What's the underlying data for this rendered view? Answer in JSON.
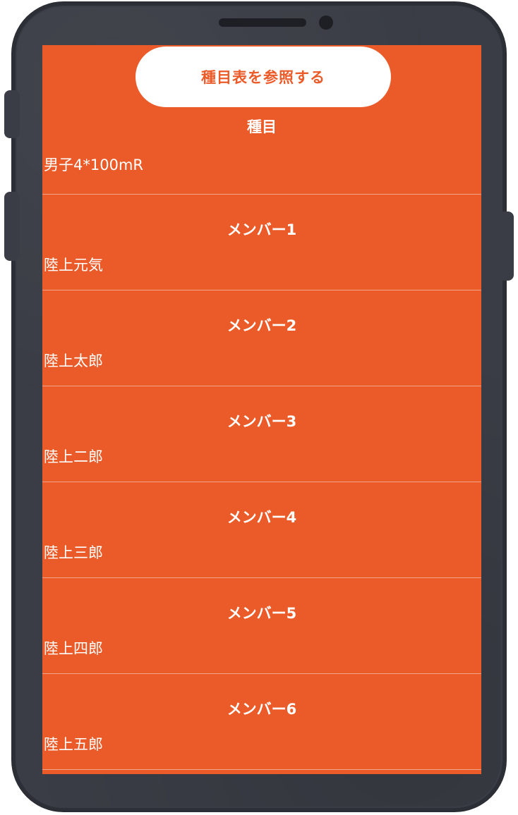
{
  "header": {
    "reference_button_label": "種目表を参照する"
  },
  "sections": [
    {
      "title": "種目",
      "value": "男子4*100mR"
    },
    {
      "title": "メンバー1",
      "value": "陸上元気"
    },
    {
      "title": "メンバー2",
      "value": "陸上太郎"
    },
    {
      "title": "メンバー3",
      "value": "陸上二郎"
    },
    {
      "title": "メンバー4",
      "value": "陸上三郎"
    },
    {
      "title": "メンバー5",
      "value": "陸上四郎"
    },
    {
      "title": "メンバー6",
      "value": "陸上五郎"
    }
  ],
  "colors": {
    "screen": "#eb5b29",
    "phone_body": "#3a3d45",
    "text": "#ffffff"
  }
}
